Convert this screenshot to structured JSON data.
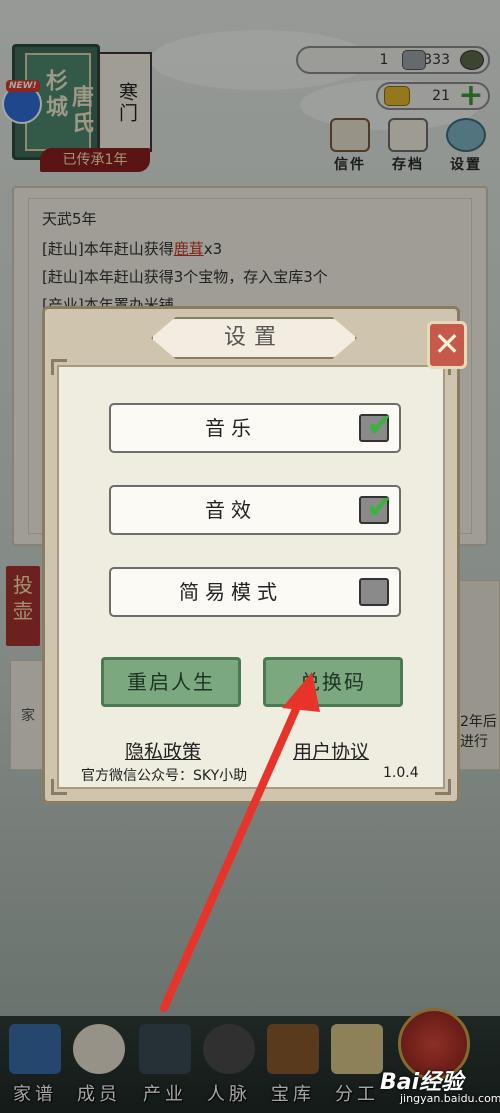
{
  "family": {
    "title_chars_1": "杉城",
    "title_chars_2": "唐氏",
    "scroll_text": "寒门",
    "new_badge": "NEW!",
    "inherit_tag": "已传承1年"
  },
  "resources": {
    "currency_1": "1",
    "currency_2": "333",
    "gold": "21"
  },
  "top_actions": [
    {
      "label": "信件"
    },
    {
      "label": "存档"
    },
    {
      "label": "设置"
    }
  ],
  "log": {
    "lines": [
      "天武5年",
      "[赶山]本年赶山获得",
      "[赶山]本年赶山获得3个宝物，存入宝库3个",
      "[产业]本年置办米铺"
    ],
    "highlight_item": "鹿茸",
    "highlight_suffix": "x3"
  },
  "side": {
    "left_red": "投壶",
    "left_card": "家",
    "right_card_line1": "2年后",
    "right_card_line2": "进行"
  },
  "dialog": {
    "title": "设置",
    "options": [
      {
        "label": "音乐",
        "checked": true
      },
      {
        "label": "音效",
        "checked": true
      },
      {
        "label": "简易模式",
        "checked": false
      }
    ],
    "restart_label": "重启人生",
    "redeem_label": "兑换码",
    "privacy_label": "隐私政策",
    "agreement_label": "用户协议",
    "wechat_text": "官方微信公众号：SKY小助",
    "version": "1.0.4"
  },
  "bottom_nav": [
    {
      "label": "家谱"
    },
    {
      "label": "成员"
    },
    {
      "label": "产业"
    },
    {
      "label": "人脉"
    },
    {
      "label": "宝库"
    },
    {
      "label": "分工"
    }
  ],
  "watermark": {
    "main": "Bai经验",
    "sub": "jingyan.baidu.com"
  },
  "colors": {
    "accent_red": "#c0392b",
    "check_green": "#3fb03f",
    "button_green": "#7ba87e",
    "arrow_red": "#e8332a"
  }
}
